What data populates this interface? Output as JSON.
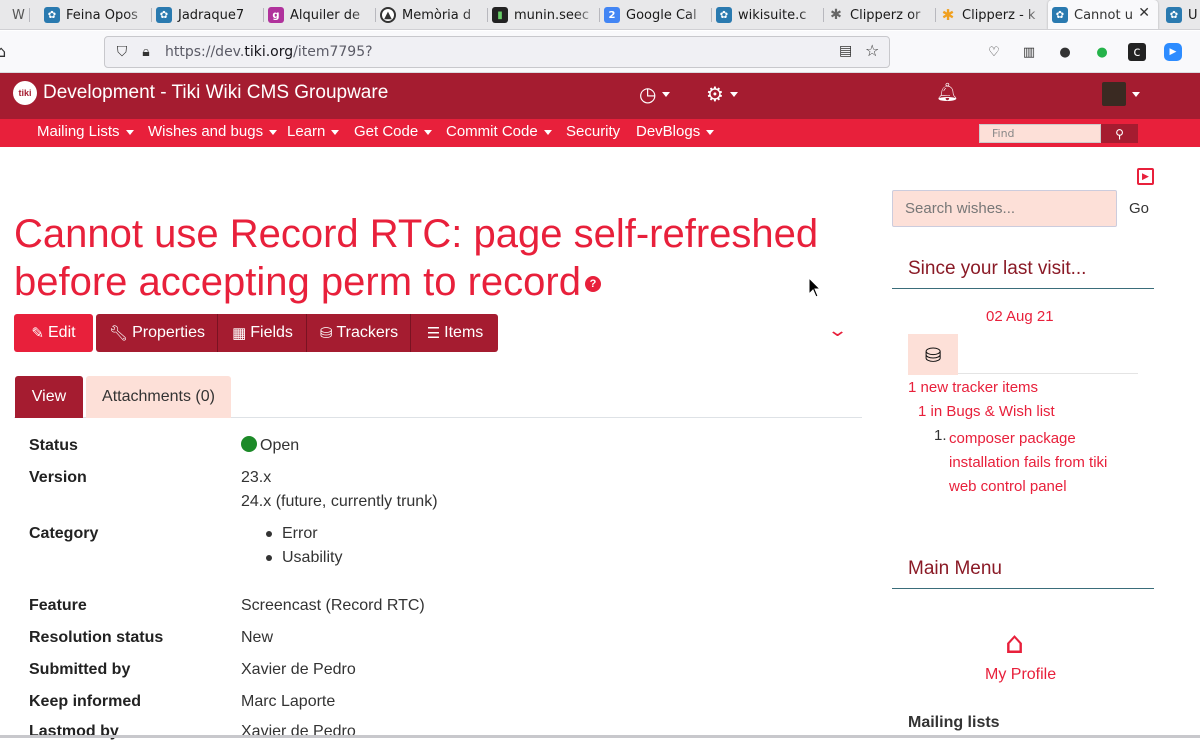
{
  "browser": {
    "tabs": [
      {
        "label": "W",
        "favicon": "tiki-icon"
      },
      {
        "label": "Feina Opos",
        "favicon": "tiki-icon"
      },
      {
        "label": "Jadraque7",
        "favicon": "tiki-icon"
      },
      {
        "label": "Alquiler de",
        "favicon": "g-icon"
      },
      {
        "label": "Memòria d",
        "favicon": "circle-icon"
      },
      {
        "label": "munin.seec",
        "favicon": "munin-icon"
      },
      {
        "label": "Google Cal",
        "favicon": "calendar-icon"
      },
      {
        "label": "wikisuite.c",
        "favicon": "tiki-icon"
      },
      {
        "label": "Clipperz or",
        "favicon": "gear-icon"
      },
      {
        "label": "Clipperz - k",
        "favicon": "star-icon"
      },
      {
        "label": "Cannot u",
        "favicon": "tiki-icon"
      },
      {
        "label": "U",
        "favicon": "tiki-icon"
      }
    ],
    "url_prefix": "https://dev.",
    "url_domain": "tiki.org",
    "url_path": "/item7795?"
  },
  "site": {
    "title": "Development - Tiki Wiki CMS Groupware",
    "logo_text": "tiki",
    "nav": [
      "Mailing Lists",
      "Wishes and bugs",
      "Learn",
      "Get Code",
      "Commit Code",
      "Security",
      "DevBlogs"
    ],
    "nav_has_caret": [
      true,
      true,
      true,
      true,
      true,
      false,
      true
    ],
    "find_placeholder": "Find"
  },
  "item": {
    "title_line1": "Cannot use Record RTC: page self-refreshed",
    "title_line2": "before accepting perm to record",
    "buttons": {
      "edit": "Edit",
      "properties": "Properties",
      "fields": "Fields",
      "trackers": "Trackers",
      "items": "Items"
    },
    "tabs": {
      "view": "View",
      "attachments": "Attachments (0)"
    },
    "fields": {
      "status_label": "Status",
      "status_value": "Open",
      "version_label": "Version",
      "version_values": [
        "23.x",
        "24.x (future, currently trunk)"
      ],
      "category_label": "Category",
      "category_values": [
        "Error",
        "Usability"
      ],
      "feature_label": "Feature",
      "feature_value": "Screencast (Record RTC)",
      "resolution_label": "Resolution status",
      "resolution_value": "New",
      "submitted_label": "Submitted by",
      "submitted_value": "Xavier de Pedro",
      "keep_label": "Keep informed",
      "keep_value": "Marc Laporte",
      "lastmod_label": "Lastmod by",
      "lastmod_value": "Xavier de Pedro"
    }
  },
  "sidebar": {
    "search_placeholder": "Search wishes...",
    "go_label": "Go",
    "since_title": "Since your last visit...",
    "since_date": "02 Aug 21",
    "new_items": "1 new tracker items",
    "bugs_list": "1 in Bugs & Wish list",
    "item_num": "1.",
    "item_title_lines": [
      "composer package",
      "installation fails from tiki",
      "web control panel"
    ],
    "main_menu_title": "Main Menu",
    "my_profile": "My Profile",
    "mailing_lists": "Mailing lists"
  },
  "colors": {
    "primary": "#a51c30",
    "accent": "#e8203b",
    "light": "#fde0d8"
  }
}
